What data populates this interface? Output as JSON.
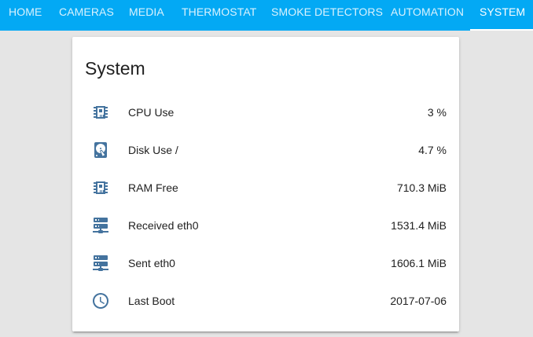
{
  "tabs": [
    {
      "label": "HOME",
      "active": false
    },
    {
      "label": "CAMERAS",
      "active": false
    },
    {
      "label": "MEDIA",
      "active": false
    },
    {
      "label": "THERMOSTAT",
      "active": false
    },
    {
      "label": "SMOKE DETECTORS",
      "active": false
    },
    {
      "label": "AUTOMATION",
      "active": false
    },
    {
      "label": "SYSTEM",
      "active": true
    }
  ],
  "card": {
    "title": "System",
    "rows": [
      {
        "icon": "chip-icon",
        "label": "CPU Use",
        "value": "3 %"
      },
      {
        "icon": "harddisk-icon",
        "label": "Disk Use /",
        "value": "4.7 %"
      },
      {
        "icon": "chip-icon",
        "label": "RAM Free",
        "value": "710.3 MiB"
      },
      {
        "icon": "server-network-icon",
        "label": "Received eth0",
        "value": "1531.4 MiB"
      },
      {
        "icon": "server-network-icon",
        "label": "Sent eth0",
        "value": "1606.1 MiB"
      },
      {
        "icon": "clock-icon",
        "label": "Last Boot",
        "value": "2017-07-06"
      }
    ]
  },
  "colors": {
    "toolbar": "#03a9f4",
    "icon": "#44739e",
    "background": "#e5e5e5",
    "card": "#ffffff"
  }
}
